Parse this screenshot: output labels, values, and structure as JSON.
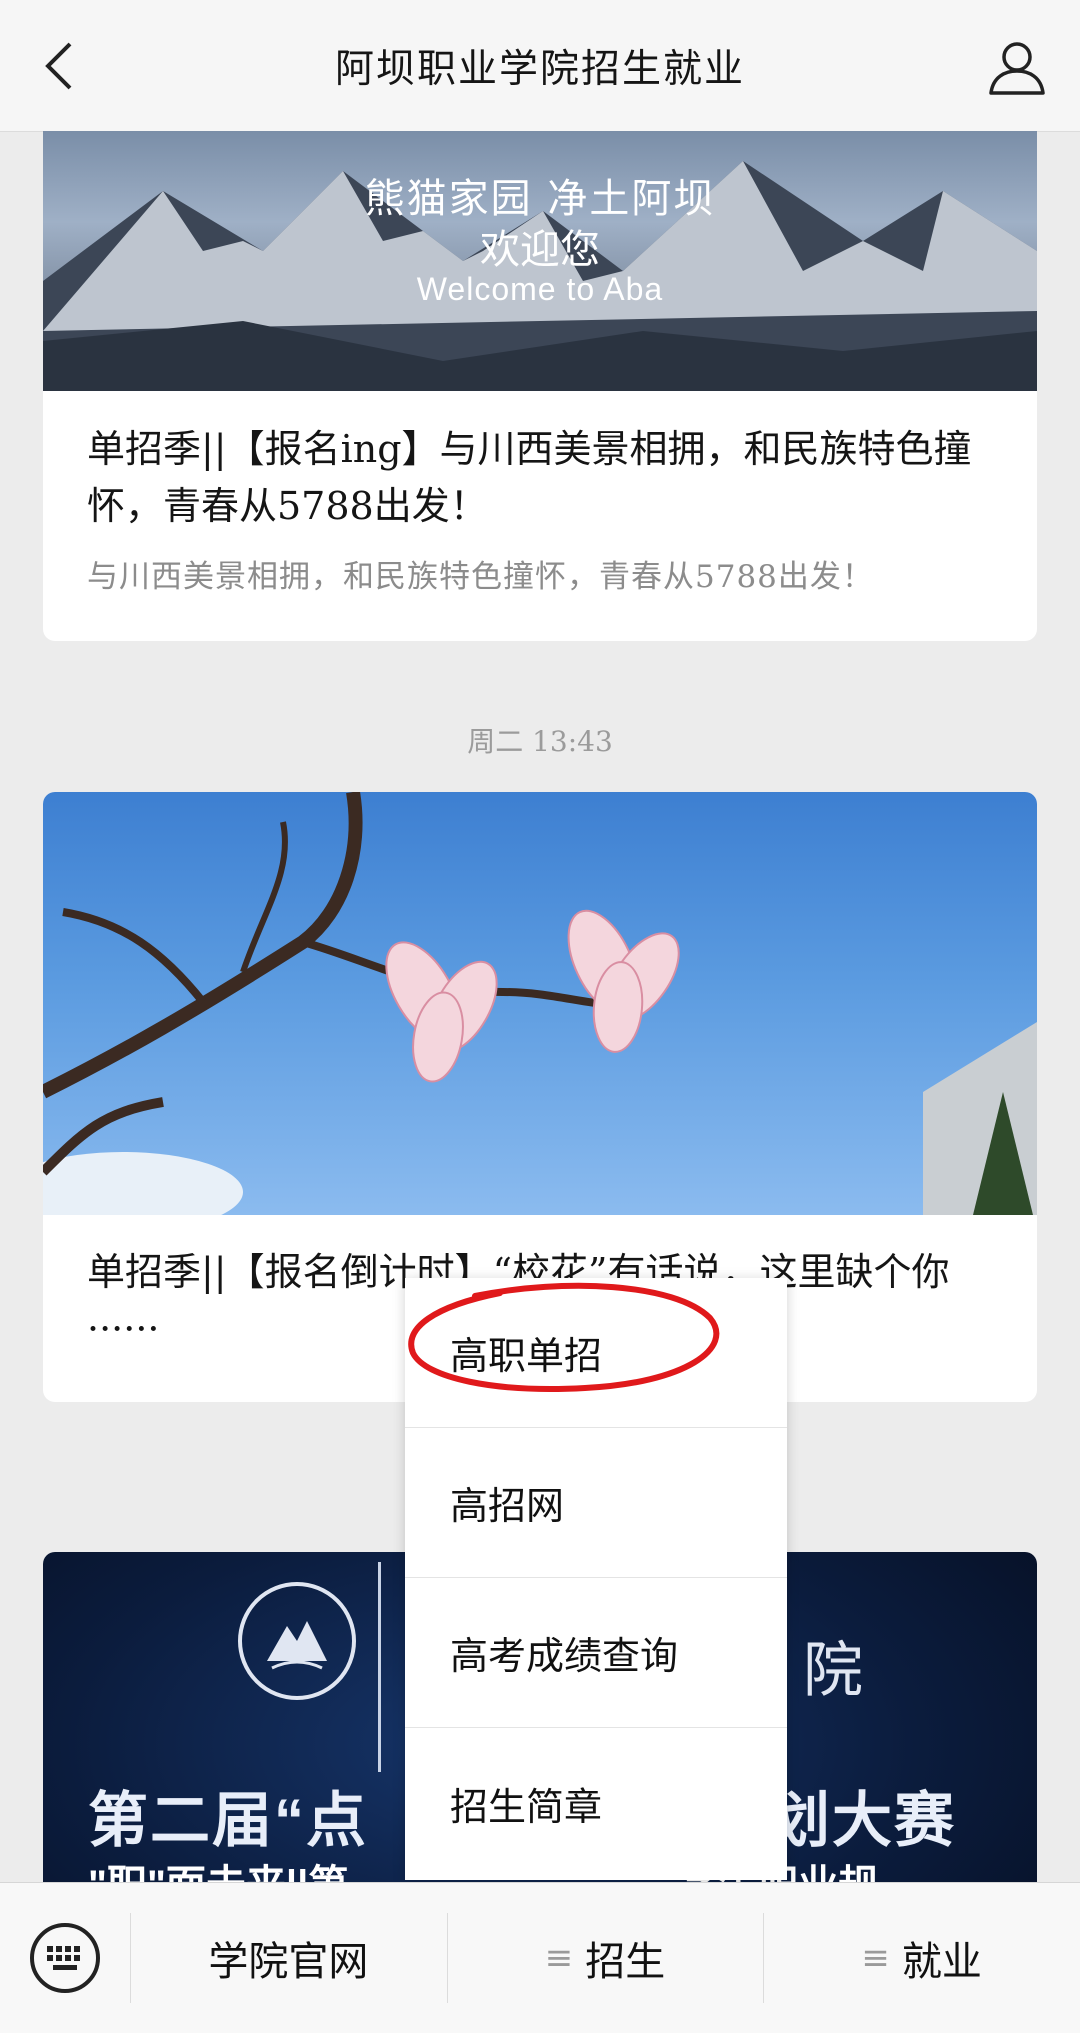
{
  "header": {
    "title": "阿坝职业学院招生就业",
    "back_icon": "chevron-left-icon",
    "profile_icon": "person-icon"
  },
  "articles": [
    {
      "image_overlay": [
        "熊猫家园 净土阿坝",
        "欢迎您",
        "Welcome to Aba"
      ],
      "title": "单招季||【报名ing】与川西美景相拥，和民族特色撞怀，青春从5788出发！",
      "digest": "与川西美景相拥，和民族特色撞怀，青春从5788出发！"
    },
    {
      "title": "单招季||【报名倒计时】“校花”有话说，这里缺个你······"
    },
    {
      "image_text_suffix": "院",
      "image_text_big": "第二届“点",
      "image_text_big_right": "规划大赛",
      "image_text_small": "\"职\"面未来||第",
      "image_text_small_right": "学生职业规"
    }
  ],
  "timestamp": "周二 13:43",
  "popup_menu": {
    "items": [
      "高职单招",
      "高招网",
      "高考成绩查询",
      "招生简章"
    ],
    "highlight_color": "#e0191b"
  },
  "bottom_bar": {
    "keyboard_icon": "keyboard-icon",
    "tabs": [
      {
        "label": "学院官网",
        "has_menu": false
      },
      {
        "label": "招生",
        "has_menu": true
      },
      {
        "label": "就业",
        "has_menu": true
      }
    ]
  }
}
